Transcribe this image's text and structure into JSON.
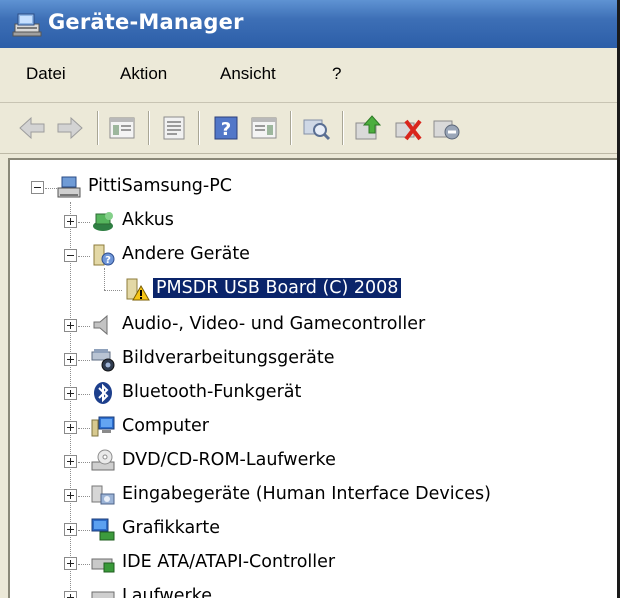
{
  "window": {
    "title": "Geräte-Manager"
  },
  "menu": {
    "items": [
      "Datei",
      "Aktion",
      "Ansicht",
      "?"
    ]
  },
  "toolbar": {
    "buttons": [
      "back-icon",
      "forward-icon",
      "show-hide-tree-icon",
      "properties-icon",
      "help-icon",
      "view-icon",
      "scan-hardware-icon",
      "update-driver-icon",
      "uninstall-icon",
      "disable-icon"
    ]
  },
  "tree": {
    "root": "PittiSamsung-PC",
    "items": [
      {
        "label": "Akkus",
        "expanded": false,
        "icon": "battery-icon"
      },
      {
        "label": "Andere Geräte",
        "expanded": true,
        "icon": "unknown-device-icon"
      },
      {
        "label": "PMSDR USB Board (C) 2008",
        "selected": true,
        "icon": "warning-device-icon"
      },
      {
        "label": "Audio-, Video- und Gamecontroller",
        "expanded": false,
        "icon": "speaker-icon"
      },
      {
        "label": "Bildverarbeitungsgeräte",
        "expanded": false,
        "icon": "camera-icon"
      },
      {
        "label": "Bluetooth-Funkgerät",
        "expanded": false,
        "icon": "bluetooth-icon"
      },
      {
        "label": "Computer",
        "expanded": false,
        "icon": "computer-icon"
      },
      {
        "label": "DVD/CD-ROM-Laufwerke",
        "expanded": false,
        "icon": "cdrom-icon"
      },
      {
        "label": "Eingabegeräte (Human Interface Devices)",
        "expanded": false,
        "icon": "hid-icon"
      },
      {
        "label": "Grafikkarte",
        "expanded": false,
        "icon": "display-adapter-icon"
      },
      {
        "label": "IDE ATA/ATAPI-Controller",
        "expanded": false,
        "icon": "ide-controller-icon"
      },
      {
        "label": "Laufwerke",
        "expanded": false,
        "icon": "drive-icon"
      }
    ]
  },
  "colors": {
    "title_bar": "#3d6fb6",
    "selection": "#0a246a",
    "chrome": "#ece9d8"
  }
}
